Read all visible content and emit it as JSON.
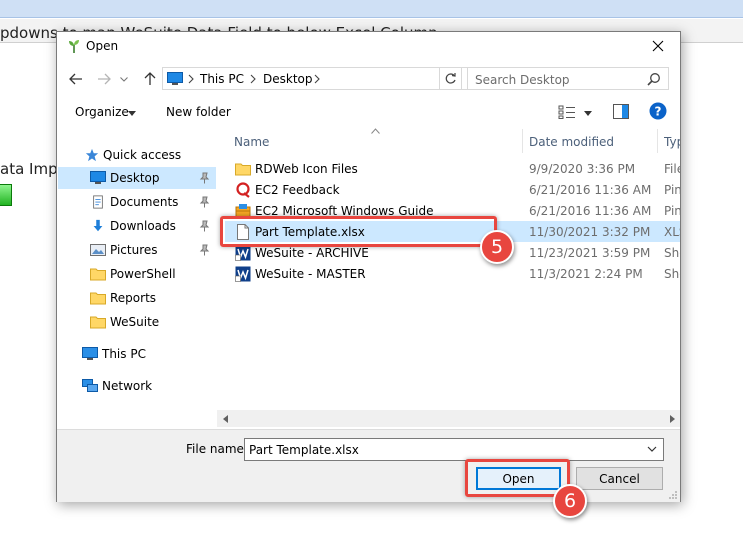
{
  "background": {
    "title_text": "pdowns to map WeSuite Data Field to below Excel Column",
    "section_text": "ata Impo"
  },
  "dialog": {
    "title": "Open",
    "address": {
      "segments": [
        "This PC",
        "Desktop"
      ]
    },
    "search": {
      "placeholder": "Search Desktop"
    },
    "toolbar": {
      "organize": "Organize",
      "new_folder": "New folder"
    },
    "nav_pane": {
      "items": [
        {
          "label": "Quick access",
          "icon": "star-icon"
        },
        {
          "label": "Desktop",
          "icon": "desktop-icon",
          "selected": true,
          "pinned": true
        },
        {
          "label": "Documents",
          "icon": "documents-icon",
          "pinned": true
        },
        {
          "label": "Downloads",
          "icon": "download-icon",
          "pinned": true
        },
        {
          "label": "Pictures",
          "icon": "pictures-icon",
          "pinned": true
        },
        {
          "label": "PowerShell",
          "icon": "folder-icon"
        },
        {
          "label": "Reports",
          "icon": "folder-icon"
        },
        {
          "label": "WeSuite",
          "icon": "folder-icon"
        },
        {
          "label": "This PC",
          "icon": "computer-icon"
        },
        {
          "label": "Network",
          "icon": "network-icon"
        }
      ]
    },
    "columns": {
      "name": "Name",
      "date_modified": "Date modified",
      "type": "Typ"
    },
    "files": [
      {
        "name": "RDWeb Icon Files",
        "date": "9/9/2020 3:36 PM",
        "type": "File",
        "icon": "folder-icon"
      },
      {
        "name": "EC2 Feedback",
        "date": "6/21/2016 11:36 AM",
        "type": "Pin",
        "icon": "feedback-icon"
      },
      {
        "name": "EC2 Microsoft Windows Guide",
        "date": "6/21/2016 11:36 AM",
        "type": "Pin",
        "icon": "guide-icon"
      },
      {
        "name": "Part Template.xlsx",
        "date": "11/30/2021 3:32 PM",
        "type": "XLS",
        "icon": "file-icon",
        "selected": true
      },
      {
        "name": "WeSuite - ARCHIVE",
        "date": "11/23/2021 3:59 PM",
        "type": "Sho",
        "icon": "wesuite-icon"
      },
      {
        "name": "WeSuite - MASTER",
        "date": "11/3/2021 2:24 PM",
        "type": "Sho",
        "icon": "wesuite-icon"
      }
    ],
    "file_name": {
      "label": "File name:",
      "value": "Part Template.xlsx"
    },
    "buttons": {
      "open": "Open",
      "cancel": "Cancel"
    }
  },
  "annotations": {
    "step_5": "5",
    "step_6": "6"
  },
  "colors": {
    "accent": "#0078d7",
    "selection": "#cce8ff",
    "callout": "#e8463f"
  }
}
